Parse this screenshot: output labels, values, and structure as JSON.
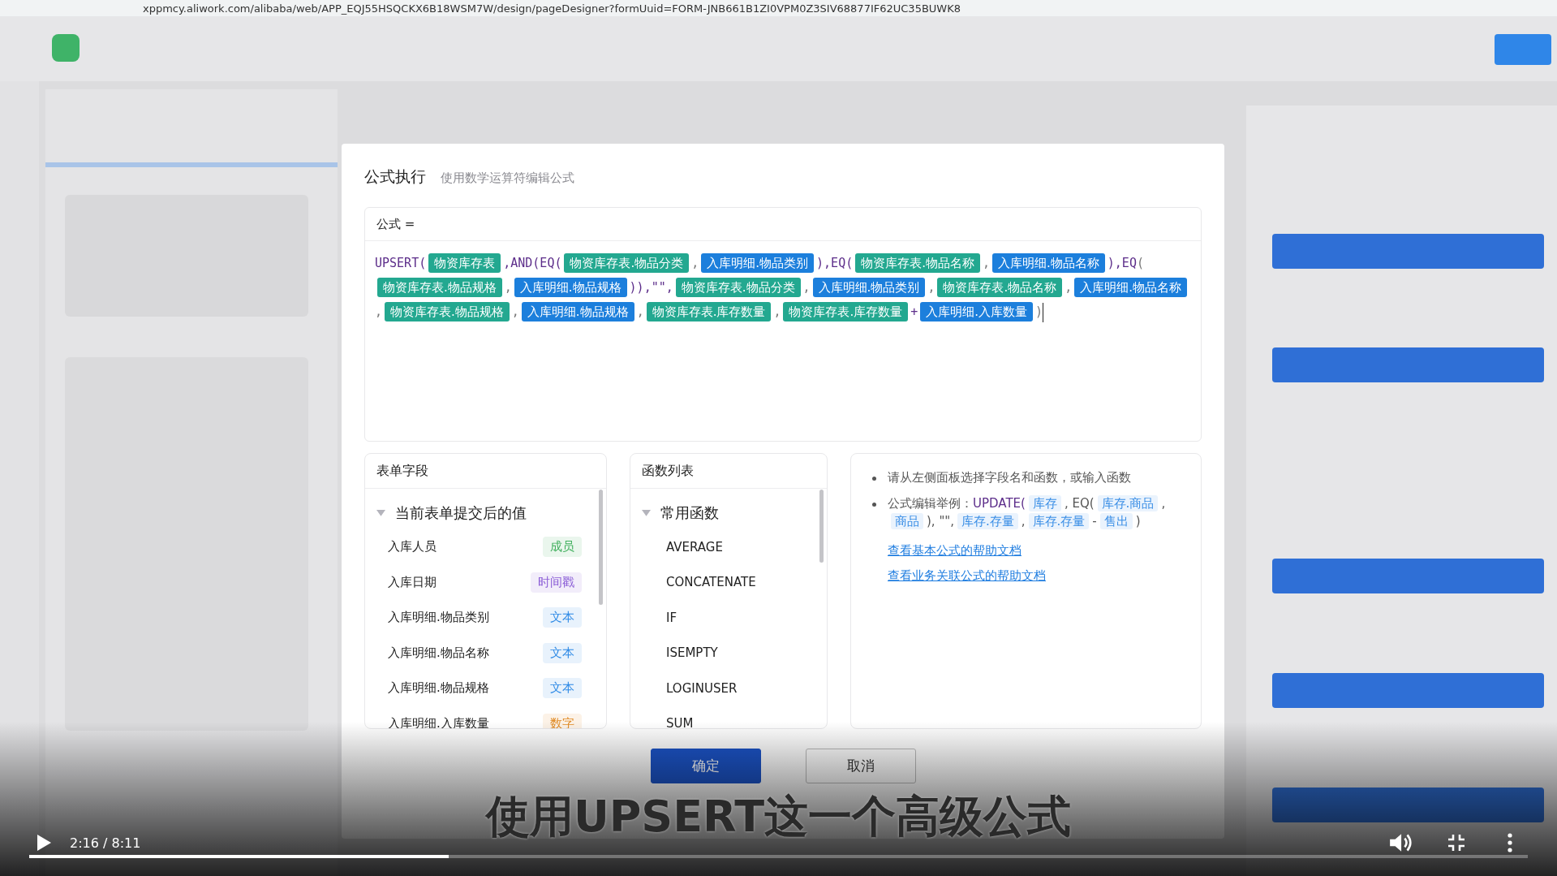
{
  "browser": {
    "url": "xppmcy.aliwork.com/alibaba/web/APP_EQJ55HSQCKX6B18WSM7W/design/pageDesigner?formUuid=FORM-JNB661B1ZI0VPM0Z3SIV68877IF62UC35BUWK8"
  },
  "dialog": {
    "title": "公式执行",
    "subtitle": "使用数学运算符编辑公式",
    "formula_label": "公式 =",
    "formula": [
      {
        "kind": "code",
        "text": "UPSERT("
      },
      {
        "kind": "table",
        "text": "物资库存表"
      },
      {
        "kind": "code",
        "text": ",AND(EQ("
      },
      {
        "kind": "table",
        "text": "物资库存表.物品分类"
      },
      {
        "kind": "sep",
        "text": ","
      },
      {
        "kind": "field",
        "text": "入库明细.物品类别"
      },
      {
        "kind": "code",
        "text": "),EQ("
      },
      {
        "kind": "table",
        "text": "物资库存表.物品名称"
      },
      {
        "kind": "sep",
        "text": ","
      },
      {
        "kind": "field",
        "text": "入库明细.物品名称"
      },
      {
        "kind": "code",
        "text": "),EQ"
      },
      {
        "kind": "sep",
        "text": "("
      },
      {
        "kind": "table",
        "text": "物资库存表.物品规格"
      },
      {
        "kind": "sep",
        "text": ","
      },
      {
        "kind": "field",
        "text": "入库明细.物品规格"
      },
      {
        "kind": "code",
        "text": ")),\"\","
      },
      {
        "kind": "table",
        "text": "物资库存表.物品分类"
      },
      {
        "kind": "sep",
        "text": ","
      },
      {
        "kind": "field",
        "text": "入库明细.物品类别"
      },
      {
        "kind": "sep",
        "text": ","
      },
      {
        "kind": "table",
        "text": "物资库存表.物品名称"
      },
      {
        "kind": "sep",
        "text": ","
      },
      {
        "kind": "field",
        "text": "入库明细.物品名称"
      },
      {
        "kind": "sep",
        "text": ","
      },
      {
        "kind": "table",
        "text": "物资库存表.物品规格"
      },
      {
        "kind": "sep",
        "text": ","
      },
      {
        "kind": "field",
        "text": "入库明细.物品规格"
      },
      {
        "kind": "sep",
        "text": ","
      },
      {
        "kind": "table",
        "text": "物资库存表.库存数量"
      },
      {
        "kind": "sep",
        "text": ","
      },
      {
        "kind": "table",
        "text": "物资库存表.库存数量"
      },
      {
        "kind": "code",
        "text": "+"
      },
      {
        "kind": "field",
        "text": "入库明细.入库数量"
      },
      {
        "kind": "sep",
        "text": ")"
      }
    ],
    "fields_panel": {
      "title": "表单字段",
      "group": {
        "label": "当前表单提交后的值",
        "expanded": true,
        "children": [
          {
            "name": "入库人员",
            "type": "成员",
            "color": "#3dae5a"
          },
          {
            "name": "入库日期",
            "type": "时间戳",
            "color": "#8a5cd6"
          },
          {
            "name": "入库明细.物品类别",
            "type": "文本",
            "color": "#2e8ae6"
          },
          {
            "name": "入库明细.物品名称",
            "type": "文本",
            "color": "#2e8ae6"
          },
          {
            "name": "入库明细.物品规格",
            "type": "文本",
            "color": "#2e8ae6"
          },
          {
            "name": "入库明细.入库数量",
            "type": "数字",
            "color": "#e08a24"
          }
        ]
      }
    },
    "functions_panel": {
      "title": "函数列表",
      "group": {
        "label": "常用函数",
        "expanded": true,
        "children": [
          "AVERAGE",
          "CONCATENATE",
          "IF",
          "ISEMPTY",
          "LOGINUSER",
          "SUM"
        ]
      }
    },
    "help": {
      "bullets": [
        [
          {
            "kind": "text",
            "text": "请从左侧面板选择字段名和函数，或输入函数"
          }
        ],
        [
          {
            "kind": "text",
            "text": "公式编辑举例："
          },
          {
            "kind": "code",
            "text": "UPDATE("
          },
          {
            "kind": "chip",
            "text": "库存"
          },
          {
            "kind": "text",
            "text": ", EQ("
          },
          {
            "kind": "chip",
            "text": "库存.商品"
          },
          {
            "kind": "text",
            "text": ","
          },
          {
            "kind": "chip",
            "text": "商品"
          },
          {
            "kind": "text",
            "text": "), \"\","
          },
          {
            "kind": "chip",
            "text": "库存.存量"
          },
          {
            "kind": "text",
            "text": ","
          },
          {
            "kind": "chip",
            "text": "库存.存量"
          },
          {
            "kind": "text",
            "text": "-"
          },
          {
            "kind": "chip",
            "text": "售出"
          },
          {
            "kind": "text",
            "text": ")"
          }
        ]
      ],
      "links": [
        "查看基本公式的帮助文档",
        "查看业务关联公式的帮助文档"
      ]
    },
    "buttons": [
      {
        "label": "确定",
        "kind": "primary"
      },
      {
        "label": "取消",
        "kind": "default"
      }
    ]
  },
  "video": {
    "subtitle": "使用UPSERT这一个高级公式",
    "time": "2:16 / 8:11",
    "playing": false,
    "level": 0.28
  }
}
